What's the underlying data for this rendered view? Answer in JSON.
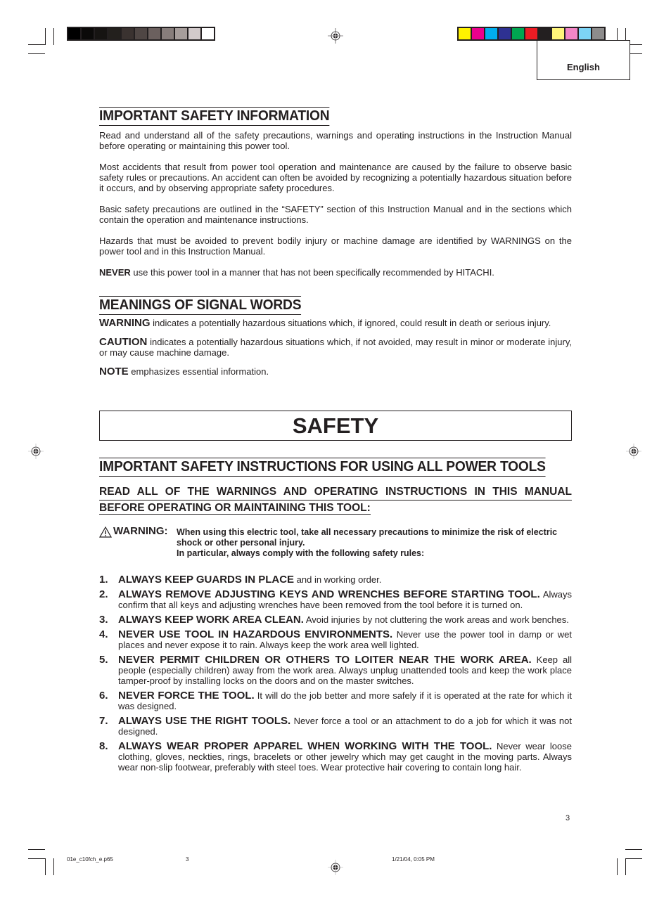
{
  "print_marks": {
    "gray_swatches": [
      "#000000",
      "#0b0a09",
      "#161412",
      "#23201d",
      "#3a3230",
      "#4f4644",
      "#6b605e",
      "#877d7b",
      "#a69d9b",
      "#d2cacb",
      "#ffffff"
    ],
    "color_swatches": [
      "#fff200",
      "#ec008c",
      "#00aeef",
      "#2e3192",
      "#00a651",
      "#ed1c24",
      "#231f20",
      "#fff57a",
      "#f386c6",
      "#7dd4f6",
      "#8d8c8c"
    ]
  },
  "language_tab": "English",
  "section1": {
    "heading": "IMPORTANT SAFETY INFORMATION",
    "paragraphs": [
      "Read and understand all of the safety precautions, warnings and operating instructions in the Instruction Manual before operating or maintaining this power tool.",
      "Most accidents that result from power tool operation and maintenance are caused by the failure to observe basic safety rules or precautions. An accident can often be avoided by recognizing a potentially hazardous situation before it occurs, and by observing appropriate safety procedures.",
      "Basic safety precautions are outlined in the “SAFETY” section of this Instruction Manual and in the sections which contain the operation and maintenance instructions.",
      "Hazards that must be avoided to prevent bodily injury or machine damage are identified by WARNINGS on the power tool and in this Instruction Manual."
    ],
    "never_label": "NEVER",
    "never_text": " use this power tool in a manner that has not been specifically recommended by HITACHI."
  },
  "section2": {
    "heading": "MEANINGS OF SIGNAL WORDS",
    "signals": [
      {
        "word": "WARNING",
        "text": " indicates a potentially hazardous situations which, if ignored, could result in death or serious injury."
      },
      {
        "word": "CAUTION",
        "text": " indicates a potentially hazardous situations which, if not avoided, may result in minor or moderate injury, or may cause machine damage."
      },
      {
        "word": "NOTE",
        "text": " emphasizes essential information."
      }
    ]
  },
  "safety_title": "SAFETY",
  "section3": {
    "heading": "IMPORTANT SAFETY INSTRUCTIONS FOR USING ALL POWER TOOLS",
    "subheading_line1": "READ ALL OF THE WARNINGS AND OPERATING INSTRUCTIONS IN THIS MANUAL",
    "subheading_line2": "BEFORE OPERATING OR MAINTAINING THIS TOOL:",
    "warning_label": "WARNING:",
    "warning_line1": "When using this electric tool, take all necessary precautions to minimize the risk of electric shock or other personal injury.",
    "warning_line2": "In particular, always comply with the following safety rules:",
    "rules": [
      {
        "num": "1.",
        "title": "ALWAYS KEEP GUARDS IN PLACE",
        "text": " and in working order."
      },
      {
        "num": "2.",
        "title": "ALWAYS REMOVE ADJUSTING KEYS AND WRENCHES BEFORE STARTING TOOL.",
        "text": " Always confirm that all keys and adjusting wrenches have been removed from the tool before it is turned on."
      },
      {
        "num": "3.",
        "title": "ALWAYS KEEP WORK AREA CLEAN.",
        "text": " Avoid injuries by not cluttering the work areas and work benches."
      },
      {
        "num": "4.",
        "title": "NEVER USE TOOL IN HAZARDOUS ENVIRONMENTS.",
        "text": " Never use the power tool in damp or wet places and never expose it to rain. Always keep the work area well lighted."
      },
      {
        "num": "5.",
        "title": "NEVER PERMIT CHILDREN OR OTHERS TO LOITER NEAR THE WORK AREA.",
        "text": " Keep all people (especially children) away from the work area. Always unplug unattended tools and keep the work place tamper-proof by installing locks on the doors and on the master switches."
      },
      {
        "num": "6.",
        "title": "NEVER FORCE THE TOOL.",
        "text": " It will do the job better and more safely if it is operated at the rate for which it was designed."
      },
      {
        "num": "7.",
        "title": "ALWAYS USE THE RIGHT TOOLS.",
        "text": " Never force a tool or an attachment to do a job for which it was not designed."
      },
      {
        "num": "8.",
        "title": "ALWAYS WEAR PROPER APPAREL WHEN WORKING WITH THE TOOL.",
        "text": " Never wear loose clothing, gloves, neckties, rings, bracelets or other jewelry which may get caught in the moving parts. Always wear non-slip footwear, preferably with steel toes. Wear protective hair covering to contain long hair."
      }
    ]
  },
  "page_number": "3",
  "slug": {
    "filename": "01e_c10fch_e.p65",
    "page": "3",
    "timestamp": "1/21/04, 0:05 PM"
  }
}
